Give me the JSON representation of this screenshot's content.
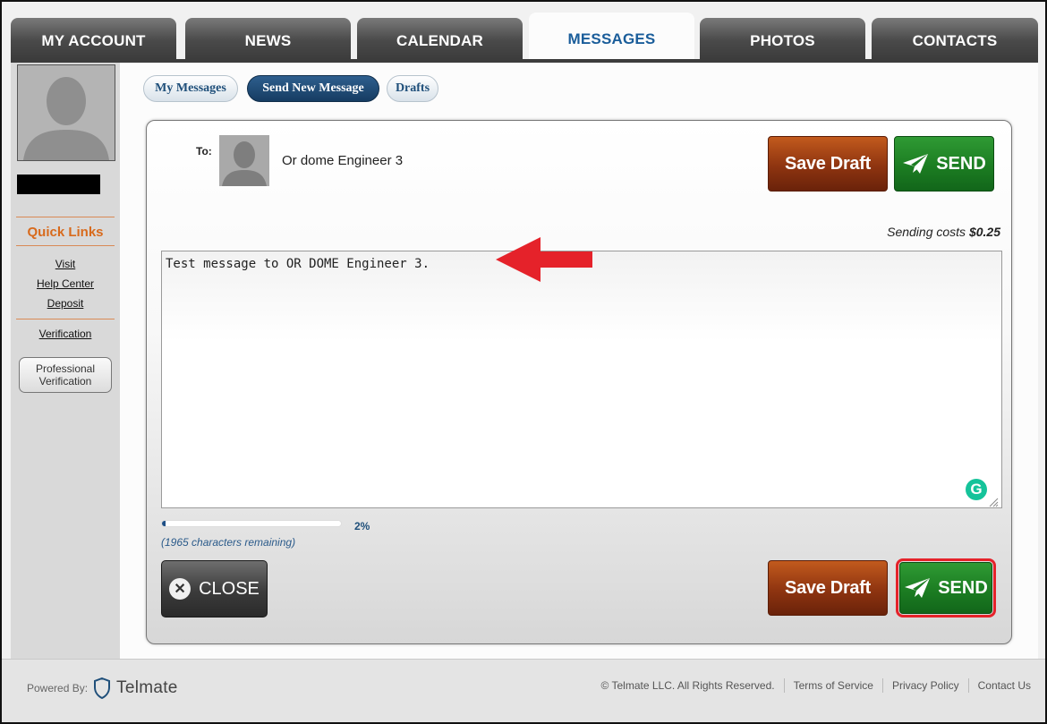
{
  "tabs": [
    {
      "label": "MY ACCOUNT"
    },
    {
      "label": "NEWS"
    },
    {
      "label": "CALENDAR"
    },
    {
      "label": "MESSAGES"
    },
    {
      "label": "PHOTOS"
    },
    {
      "label": "CONTACTS"
    }
  ],
  "active_tab": "MESSAGES",
  "subtabs": {
    "my_messages": "My Messages",
    "send_new": "Send New Message",
    "drafts": "Drafts"
  },
  "sidebar": {
    "quick_links_title": "Quick Links",
    "links": [
      "Visit",
      "Help Center",
      "Deposit"
    ],
    "verification_link": "Verification",
    "professional_button": [
      "Professional",
      "Verification"
    ]
  },
  "compose": {
    "to_label": "To:",
    "recipient": "Or dome Engineer 3",
    "save_draft_label": "Save Draft",
    "send_label": "SEND",
    "cost_prefix": "Sending costs",
    "cost_value": "$0.25",
    "message_text": "Test message to OR DOME Engineer 3.",
    "progress_percent": 2,
    "progress_label": "2%",
    "remaining_text": "(1965 characters remaining)",
    "close_label": "CLOSE",
    "grammarly_letter": "G"
  },
  "footer": {
    "powered_by": "Powered By:",
    "brand": "Telmate",
    "copyright": "© Telmate LLC. All Rights Reserved.",
    "terms": "Terms of Service",
    "privacy": "Privacy Policy",
    "contact": "Contact Us"
  },
  "colors": {
    "accent_blue": "#1a5d9a",
    "draft_brown": "#8e3410",
    "send_green": "#1c7d22",
    "quick_links_orange": "#d86a1c",
    "annotation_red": "#e5222a"
  }
}
